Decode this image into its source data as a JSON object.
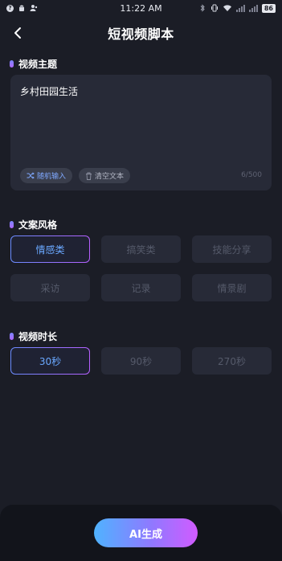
{
  "status_bar": {
    "time": "11:22 AM",
    "battery": "86"
  },
  "nav": {
    "title": "短视频脚本"
  },
  "topic": {
    "section_title": "视频主题",
    "text": "乡村田园生活",
    "random_label": "随机输入",
    "clear_label": "清空文本",
    "counter": "6/500"
  },
  "style": {
    "section_title": "文案风格",
    "options": [
      "情感类",
      "搞笑类",
      "技能分享",
      "采访",
      "记录",
      "情景剧"
    ],
    "selected": "情感类"
  },
  "duration": {
    "section_title": "视频时长",
    "options": [
      "30秒",
      "90秒",
      "270秒"
    ],
    "selected": "30秒"
  },
  "generate": {
    "label": "AI生成"
  },
  "colors": {
    "background": "#1b1d26",
    "card": "#272a37",
    "accent_blue": "#6aa8ff",
    "accent_purple": "#b660ff"
  }
}
